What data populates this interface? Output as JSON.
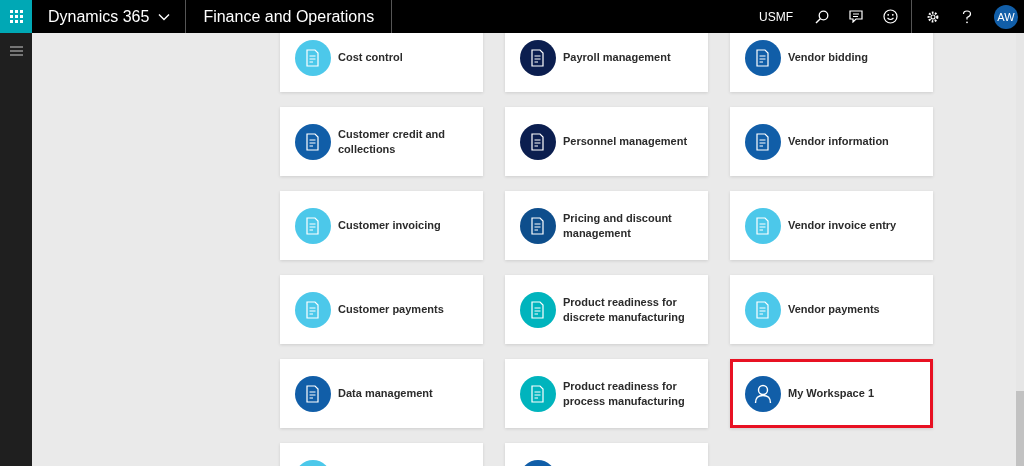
{
  "header": {
    "app_name": "Dynamics 365",
    "module": "Finance and Operations",
    "company": "USMF",
    "avatar": "AW"
  },
  "tiles": [
    {
      "label": "Cost control",
      "color": "#4cc8ea",
      "highlighted": false
    },
    {
      "label": "Payroll management",
      "color": "#0b1e4f",
      "highlighted": false
    },
    {
      "label": "Vendor bidding",
      "color": "#115ea8",
      "highlighted": false
    },
    {
      "label": "Customer credit and collections",
      "color": "#115ea8",
      "highlighted": false
    },
    {
      "label": "Personnel management",
      "color": "#0b1e4f",
      "highlighted": false
    },
    {
      "label": "Vendor information",
      "color": "#115ea8",
      "highlighted": false
    },
    {
      "label": "Customer invoicing",
      "color": "#4cc8ea",
      "highlighted": false
    },
    {
      "label": "Pricing and discount management",
      "color": "#0e4e8c",
      "highlighted": false
    },
    {
      "label": "Vendor invoice entry",
      "color": "#4cc8ea",
      "highlighted": false
    },
    {
      "label": "Customer payments",
      "color": "#4cc8ea",
      "highlighted": false
    },
    {
      "label": "Product readiness for discrete manufacturing",
      "color": "#00b4bd",
      "highlighted": false
    },
    {
      "label": "Vendor payments",
      "color": "#4cc8ea",
      "highlighted": false
    },
    {
      "label": "Data management",
      "color": "#115ea8",
      "highlighted": false
    },
    {
      "label": "Product readiness for process manufacturing",
      "color": "#00b4bd",
      "highlighted": false
    },
    {
      "label": "My Workspace 1",
      "color": "#115ea8",
      "highlighted": true
    },
    {
      "color": "#4cc8ea",
      "highlighted": false
    },
    {
      "color": "#115ea8",
      "highlighted": false
    }
  ]
}
